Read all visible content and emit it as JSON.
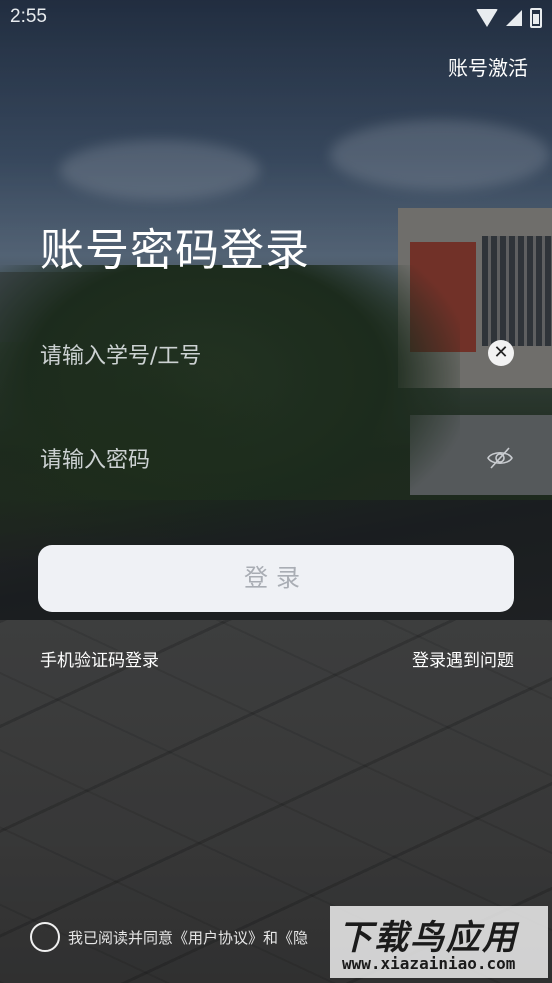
{
  "status_bar": {
    "time": "2:55"
  },
  "header": {
    "activate_label": "账号激活"
  },
  "login": {
    "title": "账号密码登录",
    "username_placeholder": "请输入学号/工号",
    "password_placeholder": "请输入密码",
    "submit_label": "登录"
  },
  "links": {
    "sms_login": "手机验证码登录",
    "problem": "登录遇到问题"
  },
  "agreement": {
    "text": "我已阅读并同意《用户协议》和《隐"
  },
  "watermark": {
    "main": "下载鸟应用",
    "sub": "www.xiazainiao.com"
  },
  "icons": {
    "clear": "close-circle-icon",
    "password_visibility": "eye-off-icon",
    "wifi": "wifi-icon",
    "signal": "signal-icon",
    "battery": "battery-icon"
  },
  "colors": {
    "button_bg": "#eff1f5",
    "button_text": "#a9adb4",
    "text": "#ffffff"
  }
}
